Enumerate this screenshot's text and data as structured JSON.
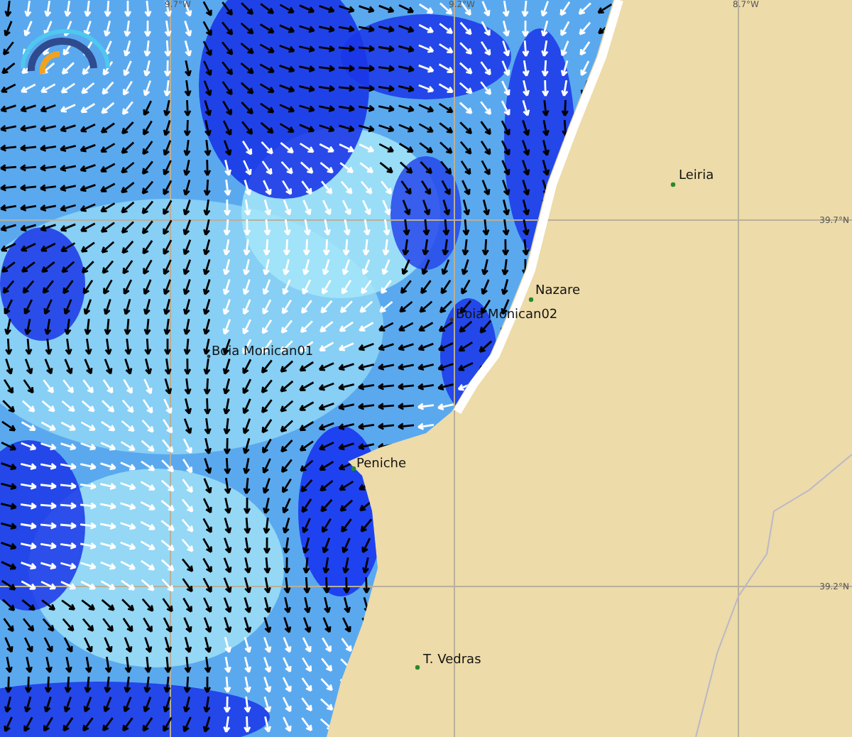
{
  "map": {
    "longitude_labels": [
      "9.7°W",
      "9.2°W",
      "8.7°W"
    ],
    "latitude_labels": [
      "39.7°N",
      "39.2°N"
    ],
    "places": [
      {
        "name": "Leiria",
        "kind": "town"
      },
      {
        "name": "Nazare",
        "kind": "town"
      },
      {
        "name": "Boia Monican02",
        "kind": "buoy"
      },
      {
        "name": "Boia Monican01",
        "kind": "buoy"
      },
      {
        "name": "Peniche",
        "kind": "town"
      },
      {
        "name": "T. Vedras",
        "kind": "town"
      }
    ]
  }
}
